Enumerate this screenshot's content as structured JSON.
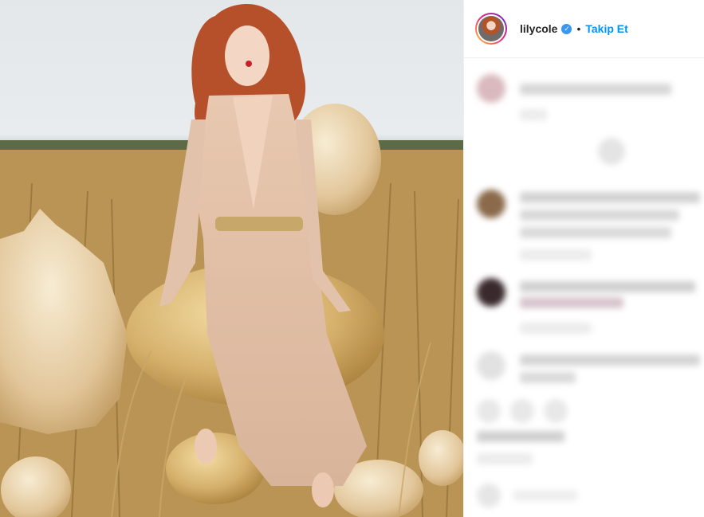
{
  "post": {
    "author": {
      "username": "lilycole",
      "verified_icon": "verified-badge-icon",
      "follow_label": "Takip Et",
      "separator": "•"
    },
    "photo": {
      "alt_subject": "fashion photo in wheat field"
    },
    "comments_blurred": true,
    "colors": {
      "accent": "#0095f6",
      "text": "#262626",
      "verified": "#3897f0"
    }
  }
}
